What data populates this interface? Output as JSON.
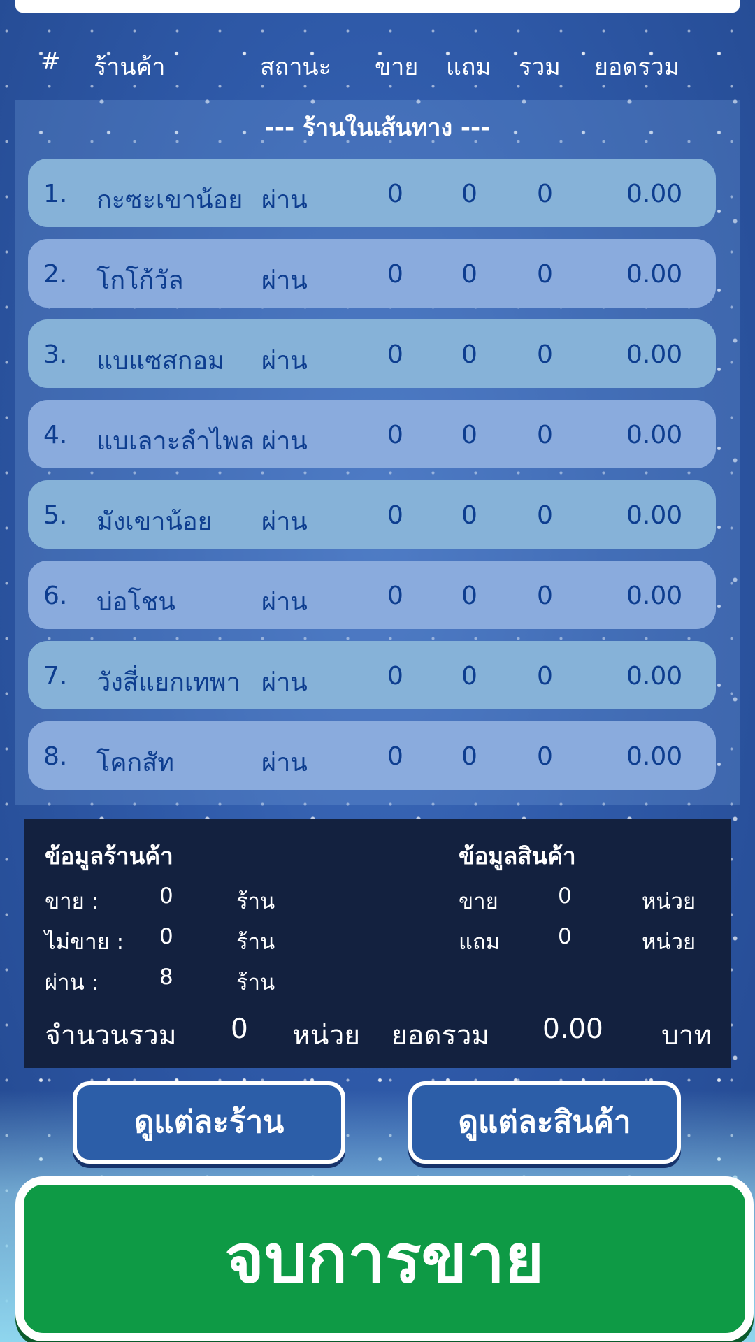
{
  "header": {
    "col_no": "#",
    "col_shop": "ร้านค้า",
    "col_status": "สถานะ",
    "col_sell": "ขาย",
    "col_free": "แถม",
    "col_total": "รวม",
    "col_amount": "ยอดรวม"
  },
  "section_title": "--- ร้านในเส้นทาง ---",
  "rows": [
    {
      "no": "1.",
      "shop": "กะซะเขาน้อย",
      "status": "ผ่าน",
      "sell": "0",
      "free": "0",
      "total": "0",
      "amount": "0.00"
    },
    {
      "no": "2.",
      "shop": "โกโก้วัล",
      "status": "ผ่าน",
      "sell": "0",
      "free": "0",
      "total": "0",
      "amount": "0.00"
    },
    {
      "no": "3.",
      "shop": "แบแซสกอม",
      "status": "ผ่าน",
      "sell": "0",
      "free": "0",
      "total": "0",
      "amount": "0.00"
    },
    {
      "no": "4.",
      "shop": "แบเลาะลำไพล",
      "status": "ผ่าน",
      "sell": "0",
      "free": "0",
      "total": "0",
      "amount": "0.00"
    },
    {
      "no": "5.",
      "shop": "มังเขาน้อย",
      "status": "ผ่าน",
      "sell": "0",
      "free": "0",
      "total": "0",
      "amount": "0.00"
    },
    {
      "no": "6.",
      "shop": "บ่อโชน",
      "status": "ผ่าน",
      "sell": "0",
      "free": "0",
      "total": "0",
      "amount": "0.00"
    },
    {
      "no": "7.",
      "shop": "วังสี่แยกเทพา",
      "status": "ผ่าน",
      "sell": "0",
      "free": "0",
      "total": "0",
      "amount": "0.00"
    },
    {
      "no": "8.",
      "shop": "โคกสัท",
      "status": "ผ่าน",
      "sell": "0",
      "free": "0",
      "total": "0",
      "amount": "0.00"
    }
  ],
  "summary": {
    "shop_title": "ข้อมูลร้านค้า",
    "product_title": "ข้อมูลสินค้า",
    "sell_label": "ขาย :",
    "sell_value": "0",
    "notsell_label": "ไม่ขาย :",
    "notsell_value": "0",
    "pass_label": "ผ่าน :",
    "pass_value": "8",
    "shop_unit": "ร้าน",
    "p_sell_label": "ขาย",
    "p_sell_value": "0",
    "p_free_label": "แถม",
    "p_free_value": "0",
    "p_unit": "หน่วย",
    "total_qty_label": "จำนวนรวม",
    "total_qty_value": "0",
    "total_qty_unit": "หน่วย",
    "total_amount_label": "ยอดรวม",
    "total_amount_value": "0.00",
    "total_amount_unit": "บาท"
  },
  "buttons": {
    "by_shop": "ดูแต่ละร้าน",
    "by_product": "ดูแต่ละสินค้า",
    "end_sale": "จบการขาย"
  },
  "colors": {
    "background": "#2f5aa9",
    "row_odd": "#86b2d8",
    "row_even": "#8aabdd",
    "row_text": "#0d3d8f",
    "summary_bg": "#13213f",
    "end_button": "#0e9a45"
  }
}
